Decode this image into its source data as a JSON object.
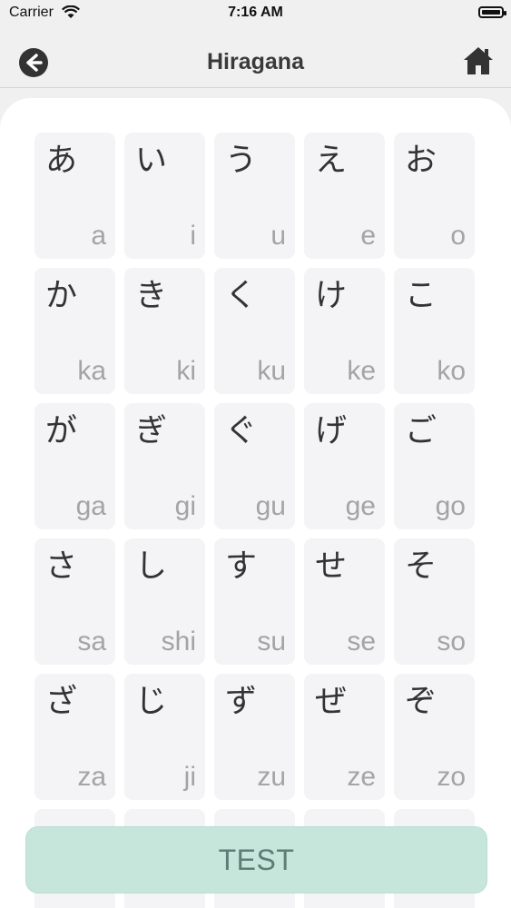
{
  "status_bar": {
    "carrier": "Carrier",
    "time": "7:16 AM"
  },
  "nav": {
    "title": "Hiragana",
    "back_icon": "arrow-left-circle-icon",
    "home_icon": "home-icon"
  },
  "cards": [
    {
      "kana": "あ",
      "romaji": "a"
    },
    {
      "kana": "い",
      "romaji": "i"
    },
    {
      "kana": "う",
      "romaji": "u"
    },
    {
      "kana": "え",
      "romaji": "e"
    },
    {
      "kana": "お",
      "romaji": "o"
    },
    {
      "kana": "か",
      "romaji": "ka"
    },
    {
      "kana": "き",
      "romaji": "ki"
    },
    {
      "kana": "く",
      "romaji": "ku"
    },
    {
      "kana": "け",
      "romaji": "ke"
    },
    {
      "kana": "こ",
      "romaji": "ko"
    },
    {
      "kana": "が",
      "romaji": "ga"
    },
    {
      "kana": "ぎ",
      "romaji": "gi"
    },
    {
      "kana": "ぐ",
      "romaji": "gu"
    },
    {
      "kana": "げ",
      "romaji": "ge"
    },
    {
      "kana": "ご",
      "romaji": "go"
    },
    {
      "kana": "さ",
      "romaji": "sa"
    },
    {
      "kana": "し",
      "romaji": "shi"
    },
    {
      "kana": "す",
      "romaji": "su"
    },
    {
      "kana": "せ",
      "romaji": "se"
    },
    {
      "kana": "そ",
      "romaji": "so"
    },
    {
      "kana": "ざ",
      "romaji": "za"
    },
    {
      "kana": "じ",
      "romaji": "ji"
    },
    {
      "kana": "ず",
      "romaji": "zu"
    },
    {
      "kana": "ぜ",
      "romaji": "ze"
    },
    {
      "kana": "ぞ",
      "romaji": "zo"
    },
    {
      "kana": "",
      "romaji": ""
    },
    {
      "kana": "",
      "romaji": ""
    },
    {
      "kana": "",
      "romaji": ""
    },
    {
      "kana": "",
      "romaji": ""
    },
    {
      "kana": "",
      "romaji": ""
    }
  ],
  "test_button": {
    "label": "TEST"
  },
  "colors": {
    "accent": "#c6e6dc",
    "card": "#f4f3f5",
    "romaji": "#a4a4a4"
  }
}
